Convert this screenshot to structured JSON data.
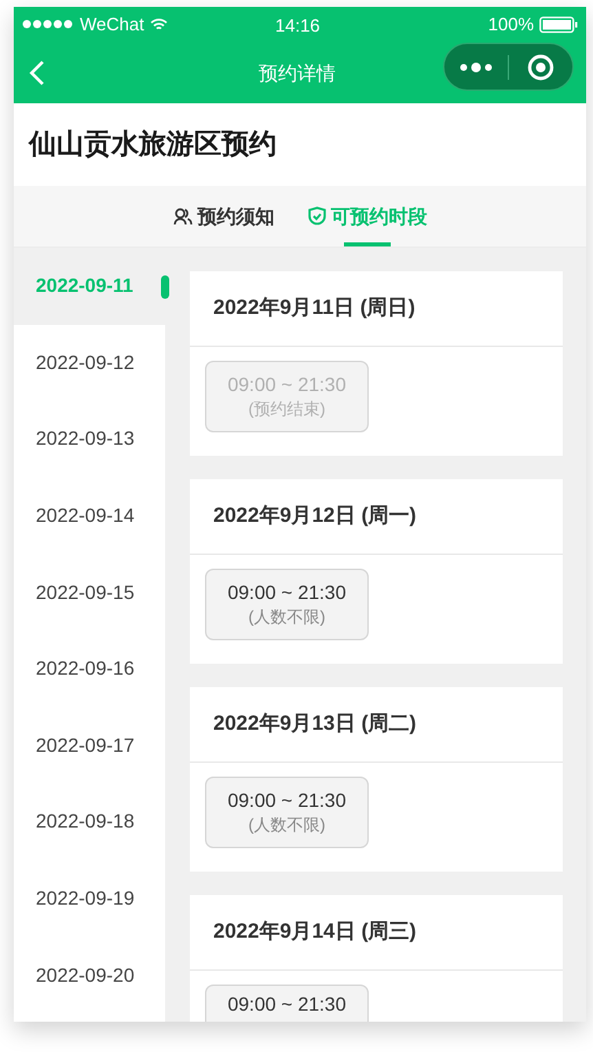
{
  "status_bar": {
    "carrier": "WeChat",
    "time": "14:16",
    "battery": "100%"
  },
  "nav": {
    "title": "预约详情"
  },
  "header": {
    "title": "仙山贡水旅游区预约"
  },
  "tabs": [
    {
      "label": "预约须知",
      "kind": "people",
      "selected": false
    },
    {
      "label": "可预约时段",
      "kind": "shield",
      "selected": true
    }
  ],
  "dates": [
    {
      "label": "2022-09-11",
      "selected": true
    },
    {
      "label": "2022-09-12",
      "selected": false
    },
    {
      "label": "2022-09-13",
      "selected": false
    },
    {
      "label": "2022-09-14",
      "selected": false
    },
    {
      "label": "2022-09-15",
      "selected": false
    },
    {
      "label": "2022-09-16",
      "selected": false
    },
    {
      "label": "2022-09-17",
      "selected": false
    },
    {
      "label": "2022-09-18",
      "selected": false
    },
    {
      "label": "2022-09-19",
      "selected": false
    },
    {
      "label": "2022-09-20",
      "selected": false
    }
  ],
  "days": [
    {
      "title": "2022年9月11日 (周日)",
      "slots": [
        {
          "time": "09:00 ~ 21:30",
          "note": "(预约结束)",
          "disabled": true
        }
      ]
    },
    {
      "title": "2022年9月12日 (周一)",
      "slots": [
        {
          "time": "09:00 ~ 21:30",
          "note": "(人数不限)",
          "disabled": false
        }
      ]
    },
    {
      "title": "2022年9月13日 (周二)",
      "slots": [
        {
          "time": "09:00 ~ 21:30",
          "note": "(人数不限)",
          "disabled": false
        }
      ]
    },
    {
      "title": "2022年9月14日 (周三)",
      "slots": [
        {
          "time": "09:00 ~ 21:30",
          "disabled": false
        }
      ]
    }
  ]
}
